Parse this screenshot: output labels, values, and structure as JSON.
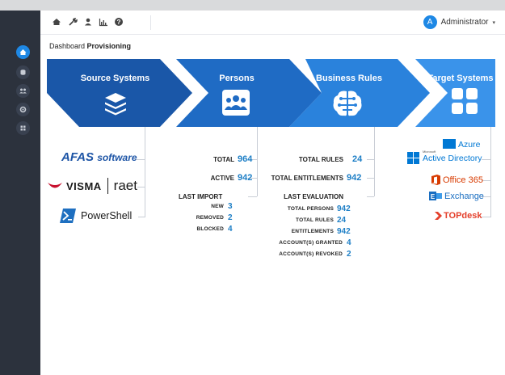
{
  "toolbar": {
    "icons": [
      "home-icon",
      "wrench-icon",
      "user-icon",
      "chart-icon",
      "help-icon"
    ]
  },
  "user": {
    "initial": "A",
    "name": "Administrator",
    "caret": "▾"
  },
  "breadcrumb": {
    "parent": "Dashboard",
    "current": "Provisioning"
  },
  "stages": [
    {
      "label": "Source Systems",
      "icon": "layers-icon",
      "color": "#1a57a8"
    },
    {
      "label": "Persons",
      "icon": "group-icon",
      "color": "#1f6bc4"
    },
    {
      "label": "Business Rules",
      "icon": "brain-icon",
      "color": "#2a82dc"
    },
    {
      "label": "Target Systems",
      "icon": "grid-icon",
      "color": "#3a93ea"
    }
  ],
  "sources": {
    "afas": {
      "text1": "AFAS",
      "text2": "software"
    },
    "visma": {
      "text1": "VISMA",
      "text2": "raet"
    },
    "powershell": {
      "text": "PowerShell"
    }
  },
  "persons": {
    "total_label": "TOTAL",
    "total": "964",
    "active_label": "ACTIVE",
    "active": "942",
    "last_import_label": "LAST IMPORT",
    "new_label": "NEW",
    "new": "3",
    "removed_label": "REMOVED",
    "removed": "2",
    "blocked_label": "BLOCKED",
    "blocked": "4"
  },
  "rules": {
    "total_rules_label": "TOTAL RULES",
    "total_rules": "24",
    "total_ent_label": "TOTAL ENTITLEMENTS",
    "total_ent": "942",
    "last_eval_label": "LAST EVALUATION",
    "ev_persons_label": "TOTAL PERSONS",
    "ev_persons": "942",
    "ev_rules_label": "TOTAL RULES",
    "ev_rules": "24",
    "ev_ent_label": "ENTITLEMENTS",
    "ev_ent": "942",
    "granted_label": "ACCOUNT(S) GRANTED",
    "granted": "4",
    "revoked_label": "ACCOUNT(S) REVOKED",
    "revoked": "2"
  },
  "targets": {
    "azure_top": "Azure",
    "azure_small": "Microsoft",
    "azure_bottom": "Active Directory",
    "office": "Office 365",
    "exchange": "Exchange",
    "topdesk": "TOPdesk"
  }
}
